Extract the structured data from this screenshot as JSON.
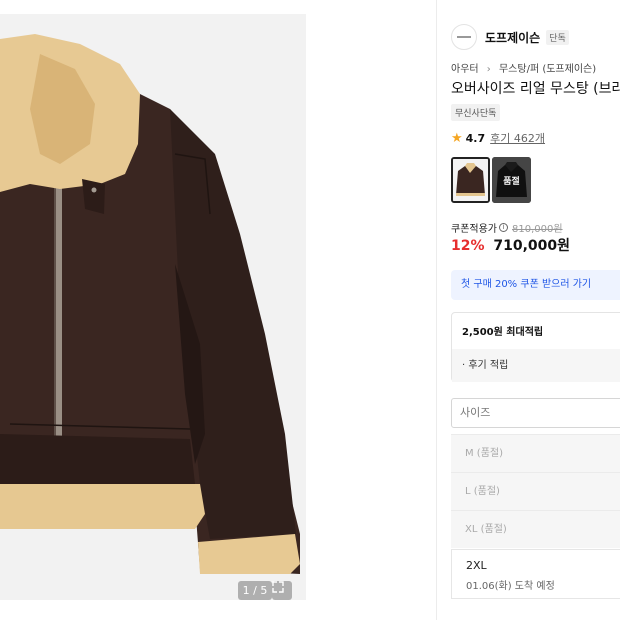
{
  "gallery": {
    "counter": "1 / 5",
    "icons": {
      "expand": "expand-icon"
    }
  },
  "brand": {
    "name": "도프제이슨",
    "tag": "단독"
  },
  "breadcrumb": {
    "level1": "아우터",
    "level2": "무스탕/퍼 (도프제이슨)"
  },
  "product": {
    "title": "오버사이즈 리얼 무스탕 (브라",
    "exclusive_badge": "무신사단독",
    "rating": "4.7",
    "reviews": "후기 462개"
  },
  "thumbnails": {
    "soldout_label": "품절"
  },
  "price": {
    "coupon_label": "쿠폰적용가",
    "original": "810,000원",
    "discount": "12%",
    "final": "710,000원"
  },
  "coupon_banner": "첫 구매 20% 쿠폰 받으러 가기",
  "points": {
    "title": "2,500원 최대적립",
    "review": "· 후기 적립"
  },
  "size": {
    "placeholder": "사이즈",
    "options": [
      {
        "label": "M (품절)"
      },
      {
        "label": "L (품절)"
      },
      {
        "label": "XL (품절)"
      }
    ],
    "available": {
      "label": "2XL",
      "eta": "01.06(화) 도착 예정"
    }
  },
  "colors": {
    "star": "#f5a623",
    "discount": "#e62e2e",
    "coupon_text": "#1f56e6",
    "coupon_bg": "#eef3ff"
  }
}
